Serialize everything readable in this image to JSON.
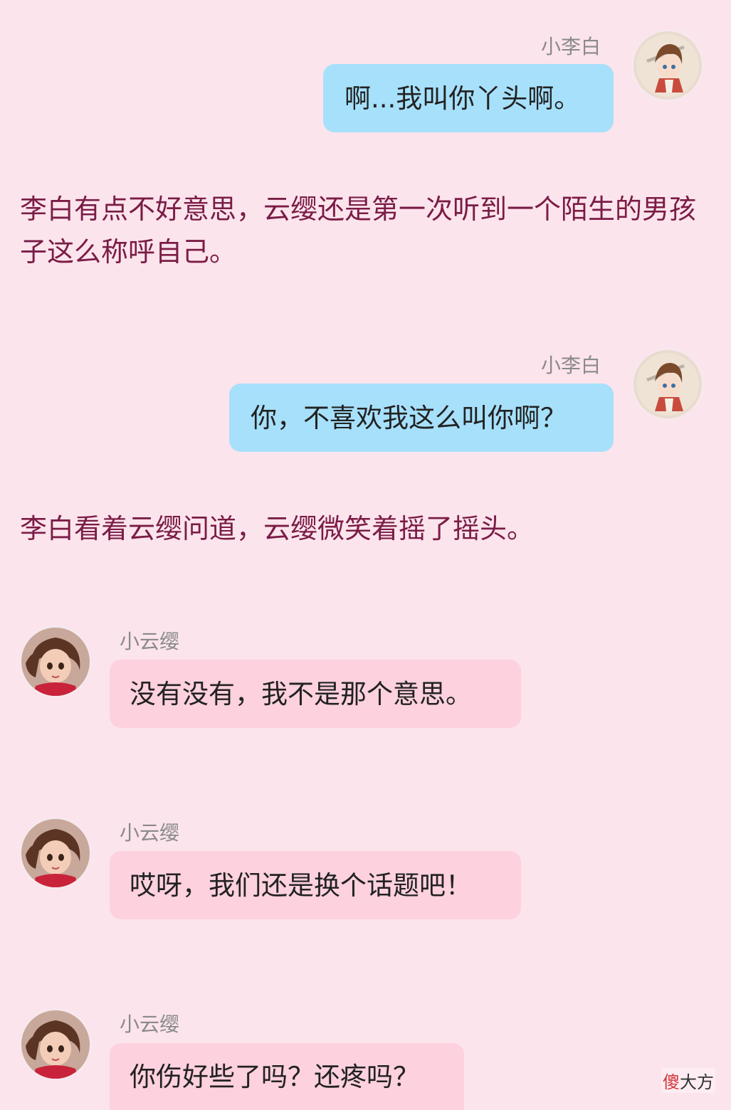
{
  "messages": [
    {
      "sender": "小李白",
      "text": "啊...我叫你丫头啊。"
    },
    {
      "narration": "李白有点不好意思，云缨还是第一次听到一个陌生的男孩子这么称呼自己。"
    },
    {
      "sender": "小李白",
      "text": "你，不喜欢我这么叫你啊？"
    },
    {
      "narration": "李白看着云缨问道，云缨微笑着摇了摇头。"
    },
    {
      "sender": "小云缨",
      "text": "没有没有，我不是那个意思。"
    },
    {
      "sender": "小云缨",
      "text": "哎呀，我们还是换个话题吧！"
    },
    {
      "sender": "小云缨",
      "text": "你伤好些了吗？还疼吗？"
    }
  ],
  "watermark": {
    "accent": "傻",
    "rest": "大方"
  },
  "colors": {
    "background": "#fce4ec",
    "my_bubble": "#a7e0fb",
    "her_bubble": "#fdd1de",
    "narration_text": "#7a1c46",
    "sender_name": "#8a8a8a"
  },
  "icons": {
    "libai_avatar": "avatar-libai-icon",
    "yunying_avatar": "avatar-yunying-icon"
  }
}
